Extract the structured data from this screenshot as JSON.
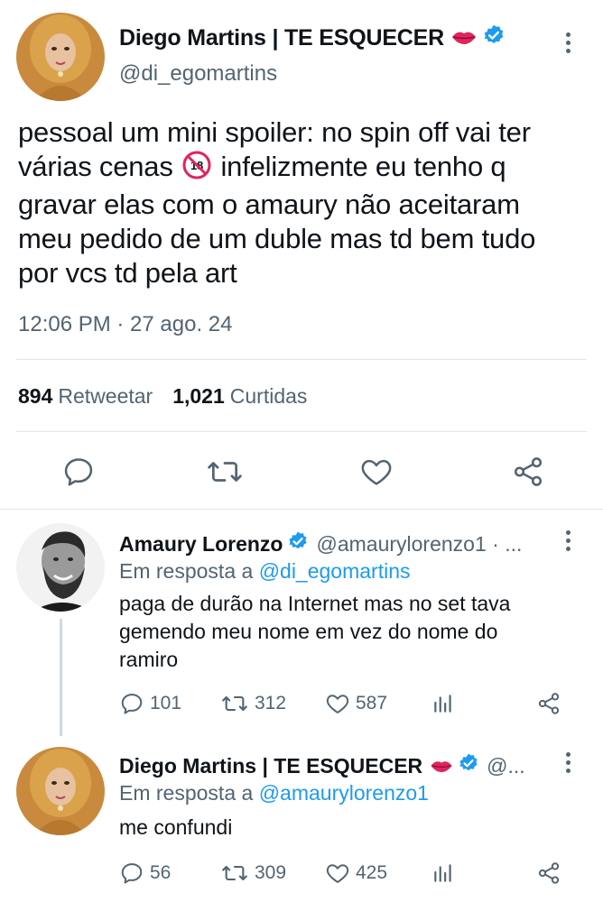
{
  "main_tweet": {
    "author_name": "Diego Martins | TE ESQUECER",
    "author_emoji": "lips-emoji",
    "handle": "@di_egomartins",
    "text_lines": [
      "pessoal um mini spoiler: no spin off vai ter",
      "várias cenas",
      "infelizmente eu tenho q",
      "gravar elas com o amaury não aceitaram",
      "meu pedido de um duble mas td bem tudo",
      "por vcs td pela art"
    ],
    "inline_emoji": "no-one-under-18-emoji",
    "timestamp": "12:06 PM · 27 ago. 24",
    "retweets_count": "894",
    "retweets_label": "Retweetar",
    "likes_count": "1,021",
    "likes_label": "Curtidas"
  },
  "replies": [
    {
      "author_name": "Amaury Lorenzo",
      "handle": "@amaurylorenzo1 · ...",
      "reply_prefix": "Em resposta a",
      "reply_target": "@di_egomartins",
      "text_lines": [
        "paga de durão na Internet mas no set tava",
        "gemendo meu nome em vez do nome do",
        "ramiro"
      ],
      "replies_count": "101",
      "retweets_count": "312",
      "likes_count": "587"
    },
    {
      "author_name": "Diego Martins | TE ESQUECER",
      "handle": "@...",
      "reply_prefix": "Em resposta a",
      "reply_target": "@amaurylorenzo1",
      "text_lines": [
        "me confundi"
      ],
      "replies_count": "56",
      "retweets_count": "309",
      "likes_count": "425"
    }
  ],
  "colors": {
    "text_primary": "#0f1419",
    "text_secondary": "#536471",
    "link": "#1d9bf0",
    "verified": "#1d9bf0",
    "divider": "#e1e6ea"
  }
}
